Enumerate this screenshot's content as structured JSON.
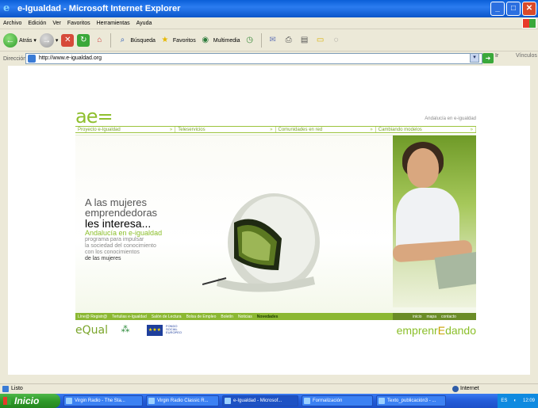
{
  "window": {
    "title": "e-Igualdad - Microsoft Internet Explorer"
  },
  "menu": [
    "Archivo",
    "Edición",
    "Ver",
    "Favoritos",
    "Herramientas",
    "Ayuda"
  ],
  "toolbar": {
    "back": "Atrás",
    "search": "Búsqueda",
    "favorites": "Favoritos",
    "media": "Multimedia"
  },
  "address": {
    "label": "Dirección",
    "url": "http://www.e-igualdad.org",
    "go": "Ir",
    "links": "Vínculos"
  },
  "site": {
    "logo": "ae=",
    "tagline": "Andalucía en e-igualdad",
    "nav": [
      "Proyecto e-Igualdad",
      "Teleservicios",
      "Comunidades en red",
      "Cambiando modelos"
    ],
    "hero": {
      "line1": "A las mujeres",
      "line2": "emprendedoras",
      "line3": "les interesa...",
      "line4": "Andalucía en e-igualdad",
      "line5": "programa para impulsar",
      "line6": "la sociedad del conocimiento",
      "line7": "con los conocimientos",
      "line8": "de las mujeres"
    },
    "bottom_nav": [
      "Líne@ Registr@",
      "Tertulias e-Igualdad",
      "Salón de Lectura",
      "Bolsa de Empleo",
      "Boletín",
      "Noticias",
      "Novedades"
    ],
    "bottom_right": [
      "inicio",
      "mapa",
      "contacto"
    ],
    "footer": {
      "equal": "eQual",
      "junta": "JUNTA DE ANDALUCÍA",
      "eu_lines": [
        "FONDO",
        "SOCIAL",
        "EUROPEO"
      ],
      "brand_a": "emprenr",
      "brand_b": "E",
      "brand_c": "dando"
    }
  },
  "status": {
    "text": "Listo",
    "zone": "Internet"
  },
  "taskbar": {
    "start": "Inicio",
    "tasks": [
      "Virgin Radio - The Sta...",
      "Virgin Radio Classic R...",
      "e-Igualdad - Microsof...",
      "Formalización",
      "Texto_publicación3 - ..."
    ],
    "lang": "ES",
    "clock": "12:09"
  }
}
